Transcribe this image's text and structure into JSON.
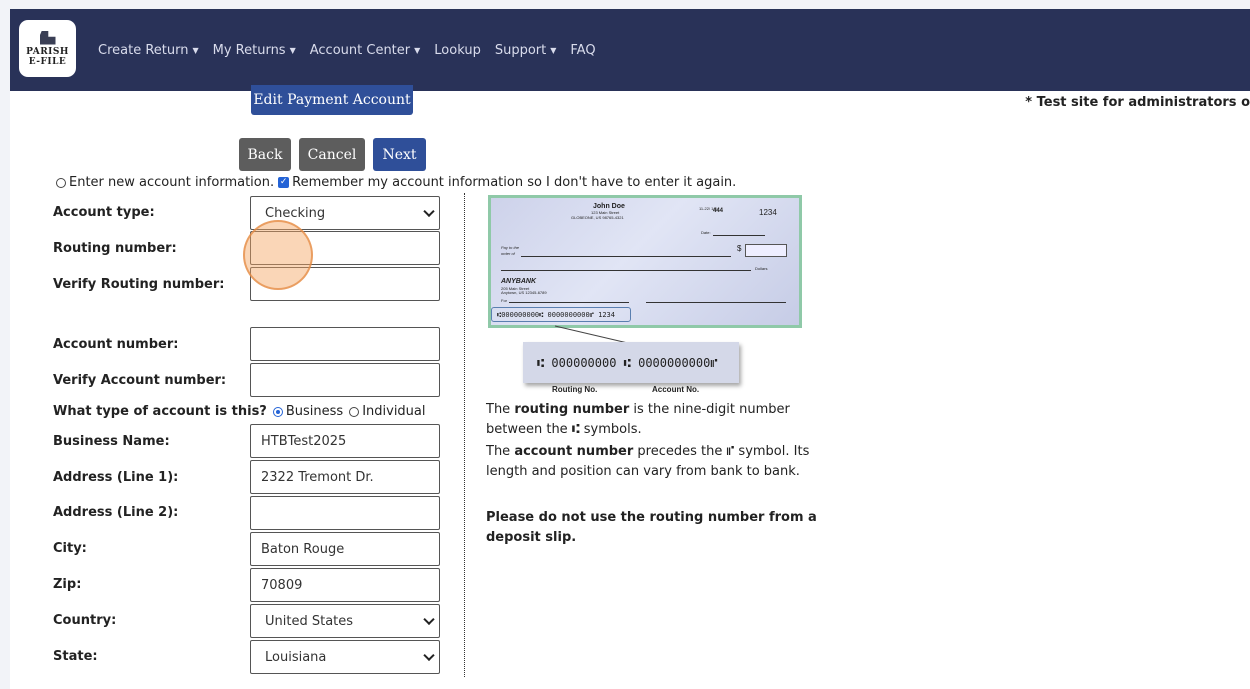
{
  "nav": {
    "logo_line1": "PARISH",
    "logo_line2": "E-FILE",
    "items": [
      {
        "label": "Create Return",
        "dropdown": true
      },
      {
        "label": "My Returns",
        "dropdown": true
      },
      {
        "label": "Account Center",
        "dropdown": true
      },
      {
        "label": "Lookup",
        "dropdown": false
      },
      {
        "label": "Support",
        "dropdown": true
      },
      {
        "label": "FAQ",
        "dropdown": false
      }
    ]
  },
  "buttons": {
    "edit_payment": "Edit Payment Account",
    "back": "Back",
    "cancel": "Cancel",
    "next": "Next"
  },
  "notice": "* Test site for administrators o",
  "options": {
    "new_account": "Enter new account information.",
    "remember": "Remember my account information so I don't have to enter it again."
  },
  "form": {
    "account_type": {
      "label": "Account type:",
      "value": "Checking"
    },
    "routing": {
      "label": "Routing number:",
      "value": ""
    },
    "verify_routing": {
      "label": "Verify Routing number:",
      "value": ""
    },
    "account_number": {
      "label": "Account number:",
      "value": ""
    },
    "verify_account": {
      "label": "Verify Account number:",
      "value": ""
    },
    "account_kind": {
      "question": "What type of account is this?",
      "business": "Business",
      "individual": "Individual",
      "selected": "Business"
    },
    "business_name": {
      "label": "Business Name:",
      "value": "HTBTest2025"
    },
    "address1": {
      "label": "Address (Line 1):",
      "value": "2322 Tremont Dr."
    },
    "address2": {
      "label": "Address (Line 2):",
      "value": ""
    },
    "city": {
      "label": "City:",
      "value": "Baton Rouge"
    },
    "zip": {
      "label": "Zip:",
      "value": "70809"
    },
    "country": {
      "label": "Country:",
      "value": "United States"
    },
    "state": {
      "label": "State:",
      "value": "Louisiana"
    }
  },
  "check_image": {
    "name": "John Doe",
    "address1": "123 Main Street",
    "address2": "GLOBEONE, US 98765-4321",
    "fraction": "11-22/ 1/8",
    "fraction_num": "444",
    "check_no": "1234",
    "date_label": "Date:",
    "pay_to": "Pay to the",
    "order_of": "order of",
    "dollar_sign": "$",
    "dollars": "Dollars",
    "bank": "ANYBANK",
    "bank_addr1": "205 Main Street",
    "bank_addr2": "Anytown, US 12345-6789",
    "for_label": "For",
    "micr": "⑆000000000⑆ 0000000000⑈ 1234",
    "zoom_micr": "⑆ 000000000 ⑆  0000000000⑈",
    "routing_label": "Routing No.",
    "account_label": "Account No."
  },
  "info": {
    "p1_a": "The ",
    "p1_b": "routing number",
    "p1_c": " is the nine-digit number between the ⑆ symbols.",
    "p2_a": "The ",
    "p2_b": "account number",
    "p2_c": " precedes the ⑈ symbol. Its length and position can vary from bank to bank.",
    "warning": "Please do not use the routing number from a deposit slip."
  }
}
